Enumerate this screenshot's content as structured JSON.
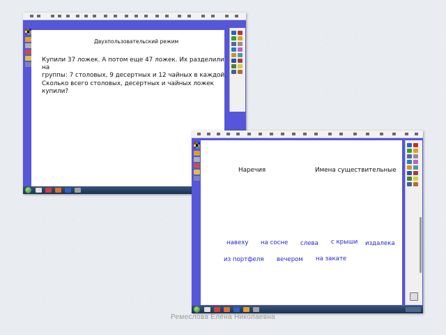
{
  "colors": {
    "frame_blue": "#5656d8",
    "canvas": "#ffffff",
    "word_blue": "#2424d4",
    "taskbar": "#1c3150"
  },
  "screen1": {
    "mode_title": "Двухпользовательский режим",
    "problem_lines": [
      "Купили 37 ложек. А потом еще 47 ложек. Их разделили на",
      "группы: 7 столовых, 9 десертных и 12 чайных в каждой.",
      "Сколько всего столовых, десертных и чайных ложек",
      "купили?"
    ]
  },
  "screen2": {
    "column_left": "Наречия",
    "column_right": "Имена существительные",
    "words": [
      "навеху",
      "на сосне",
      "слева",
      "с крыши",
      "издалека",
      "из портфеля",
      "вечером",
      "на закате"
    ]
  },
  "caption": "Ремеслова Елена Николаевна"
}
